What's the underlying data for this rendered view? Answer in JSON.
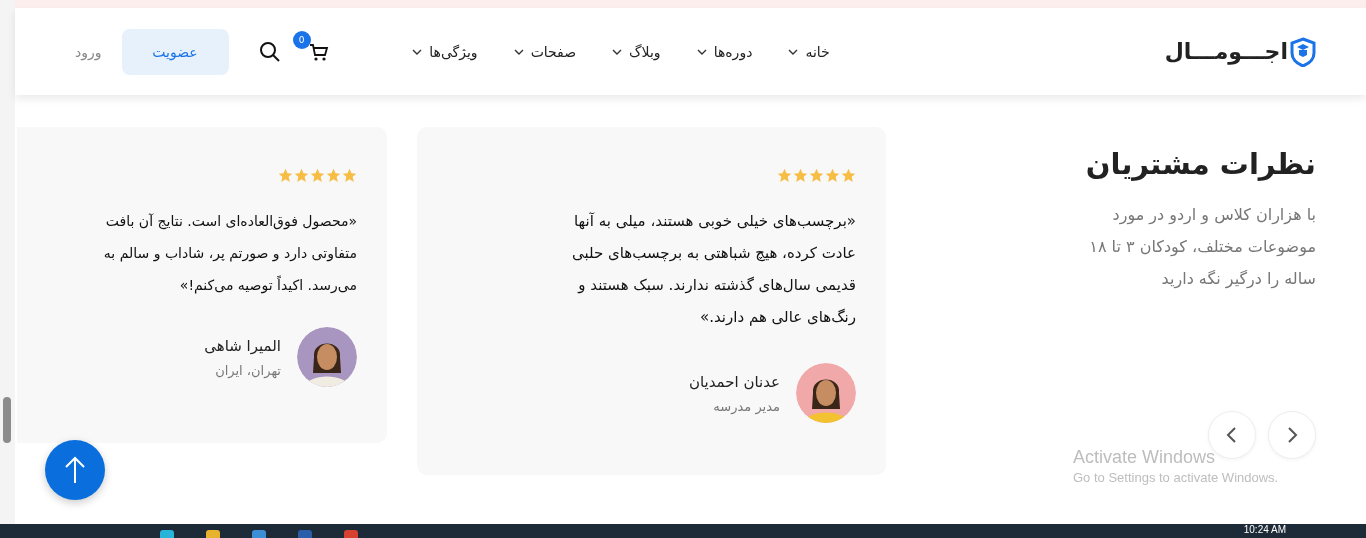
{
  "header": {
    "logo": "اجـــومـــال",
    "nav": [
      {
        "label": "خانه"
      },
      {
        "label": "دوره‌ها"
      },
      {
        "label": "وبلاگ"
      },
      {
        "label": "صفحات"
      },
      {
        "label": "ویژگی‌ها"
      }
    ],
    "cart_count": "0",
    "signup": "عضویت",
    "login": "ورود"
  },
  "section": {
    "title": "نظرات مشتریان",
    "description": "با هزاران کلاس و اردو در مورد موضوعات مختلف، کودکان ۳ تا ۱۸ ساله را درگیر نگه دارید"
  },
  "testimonials": [
    {
      "stars": 5,
      "quote_lines": [
        "«برچسب‌های خیلی خوبی هستند، میلی به آنها",
        "عادت کرده، هیچ شباهتی به برچسب‌های حلبی",
        "قدیمی سال‌های گذشته ندارند. سبک هستند و",
        "رنگ‌های عالی هم دارند.»"
      ],
      "name": "عدنان احمدیان",
      "role": "مدیر مدرسه"
    },
    {
      "stars": 5,
      "quote_lines": [
        "«محصول فوق‌العاده‌ای است. نتایج آن بافت",
        "متفاوتی دارد و صورتم پر، شاداب و سالم به",
        "می‌رسد. اکیداً توصیه می‌کنم!»"
      ],
      "name": "المیرا شاهی",
      "role": "تهران، ایران"
    }
  ],
  "windows_notice": {
    "title": "Activate Windows",
    "text": "Go to Settings to activate Windows."
  },
  "taskbar": {
    "time": "10:24 AM"
  }
}
